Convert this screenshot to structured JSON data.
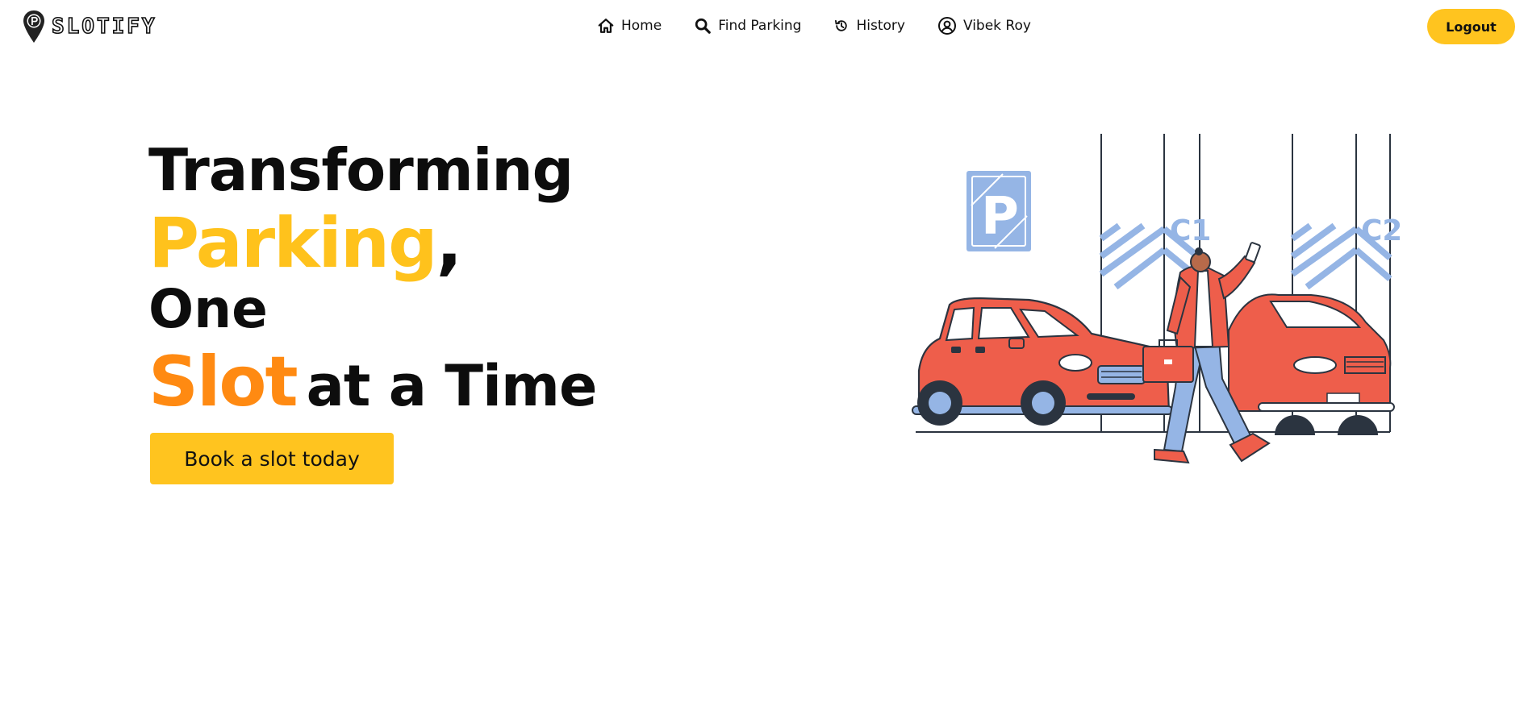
{
  "brand": {
    "name": "SLOTIFY",
    "logo_icon": "location-pin-parking-icon"
  },
  "nav": {
    "items": [
      {
        "label": "Home",
        "icon": "home-icon"
      },
      {
        "label": "Find Parking",
        "icon": "search-icon"
      },
      {
        "label": "History",
        "icon": "history-icon"
      },
      {
        "label": "Vibek Roy",
        "icon": "user-circle-icon"
      }
    ],
    "logout_label": "Logout"
  },
  "hero": {
    "line1": "Transforming",
    "line2_highlight": "Parking",
    "line2_punct": ",",
    "line3": "One",
    "line4_highlight": "Slot",
    "line4_rest": "at a Time",
    "cta_label": "Book a slot today"
  },
  "illustration": {
    "slot_labels": [
      "C1",
      "C2"
    ],
    "sign_letter": "P"
  },
  "colors": {
    "accent_yellow": "#FFC41F",
    "accent_orange": "#FF8A12",
    "car_red": "#EE5E4B",
    "illustration_blue": "#95B5E5",
    "text_dark": "#0d0d0d"
  }
}
